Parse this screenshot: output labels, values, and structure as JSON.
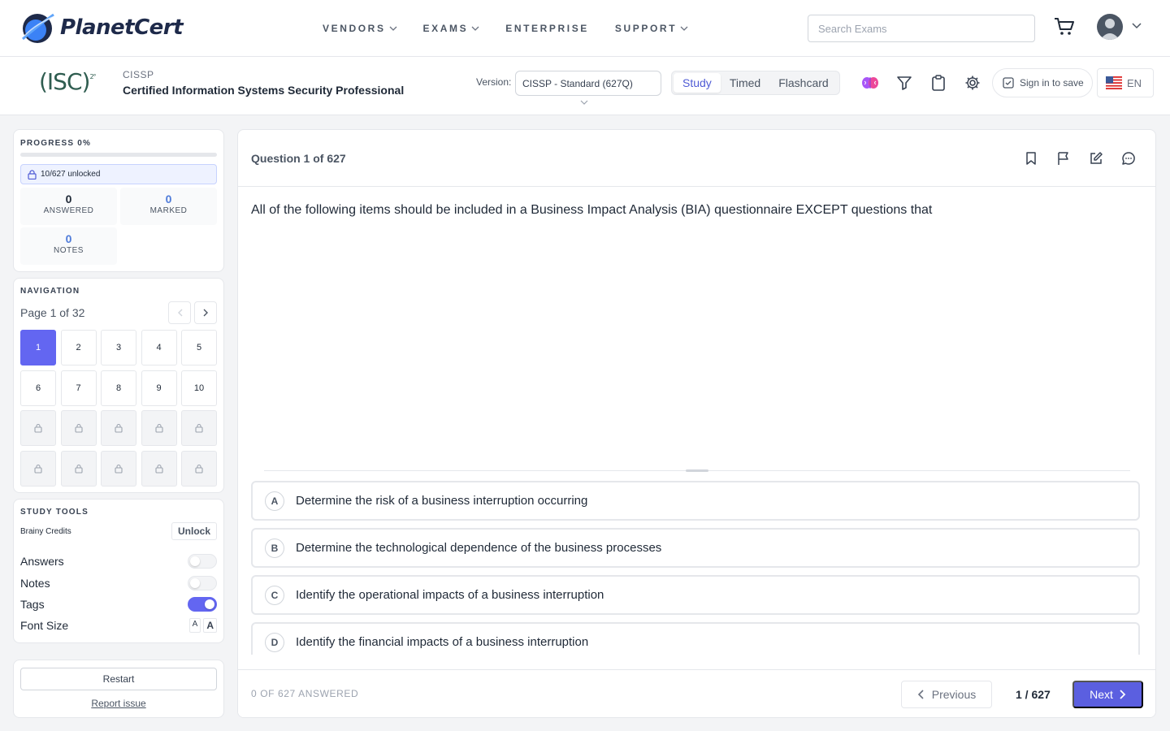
{
  "brand": {
    "name": "PlanetCert"
  },
  "nav": {
    "items": [
      {
        "label": "VENDORS",
        "has_dropdown": true
      },
      {
        "label": "EXAMS",
        "has_dropdown": true
      },
      {
        "label": "ENTERPRISE",
        "has_dropdown": false
      },
      {
        "label": "SUPPORT",
        "has_dropdown": true
      }
    ],
    "search_placeholder": "Search Exams"
  },
  "exam": {
    "vendor_logo": "(ISC)",
    "vendor_logo_sup": "2°",
    "code": "CISSP",
    "name": "Certified Information Systems Security Professional",
    "version_label": "Version:",
    "version_value": "CISSP - Standard (627Q)",
    "modes": [
      "Study",
      "Timed",
      "Flashcard"
    ],
    "active_mode": "Study",
    "sign_in_label": "Sign in to save",
    "language": "EN"
  },
  "progress": {
    "title": "PROGRESS 0%",
    "percent": 0,
    "unlocked_text": "10/627 unlocked",
    "stats": [
      {
        "value": "0",
        "label": "ANSWERED",
        "color": "#111827"
      },
      {
        "value": "0",
        "label": "MARKED",
        "color": "#4f7bd9"
      },
      {
        "value": "0",
        "label": "NOTES",
        "color": "#4f7bd9"
      }
    ]
  },
  "navigation": {
    "title": "NAVIGATION",
    "page_label": "Page 1 of 32",
    "cells": [
      "1",
      "2",
      "3",
      "4",
      "5",
      "6",
      "7",
      "8",
      "9",
      "10"
    ],
    "active_cell": "1",
    "locked_count": 10
  },
  "study_tools": {
    "title": "STUDY TOOLS",
    "credits_label": "Brainy Credits",
    "unlock_label": "Unlock",
    "toggles": [
      {
        "label": "Answers",
        "on": false
      },
      {
        "label": "Notes",
        "on": false
      },
      {
        "label": "Tags",
        "on": true
      }
    ],
    "font_size_label": "Font Size",
    "font_small": "A",
    "font_big": "A"
  },
  "actions": {
    "restart_label": "Restart",
    "report_label": "Report issue"
  },
  "question": {
    "number_label": "Question 1 of 627",
    "text": "All of the following items should be included in a Business Impact Analysis (BIA) questionnaire EXCEPT questions that",
    "options": [
      {
        "letter": "A",
        "text": "Determine the risk of a business interruption occurring"
      },
      {
        "letter": "B",
        "text": "Determine the technological dependence of the business processes"
      },
      {
        "letter": "C",
        "text": "Identify the operational impacts of a business interruption"
      },
      {
        "letter": "D",
        "text": "Identify the financial impacts of a business interruption"
      }
    ]
  },
  "footer": {
    "answered_label": "0 OF 627 ANSWERED",
    "previous_label": "Previous",
    "counter": "1 / 627",
    "next_label": "Next"
  },
  "colors": {
    "accent": "#6366f1",
    "next_button": "#5b5fe0"
  }
}
